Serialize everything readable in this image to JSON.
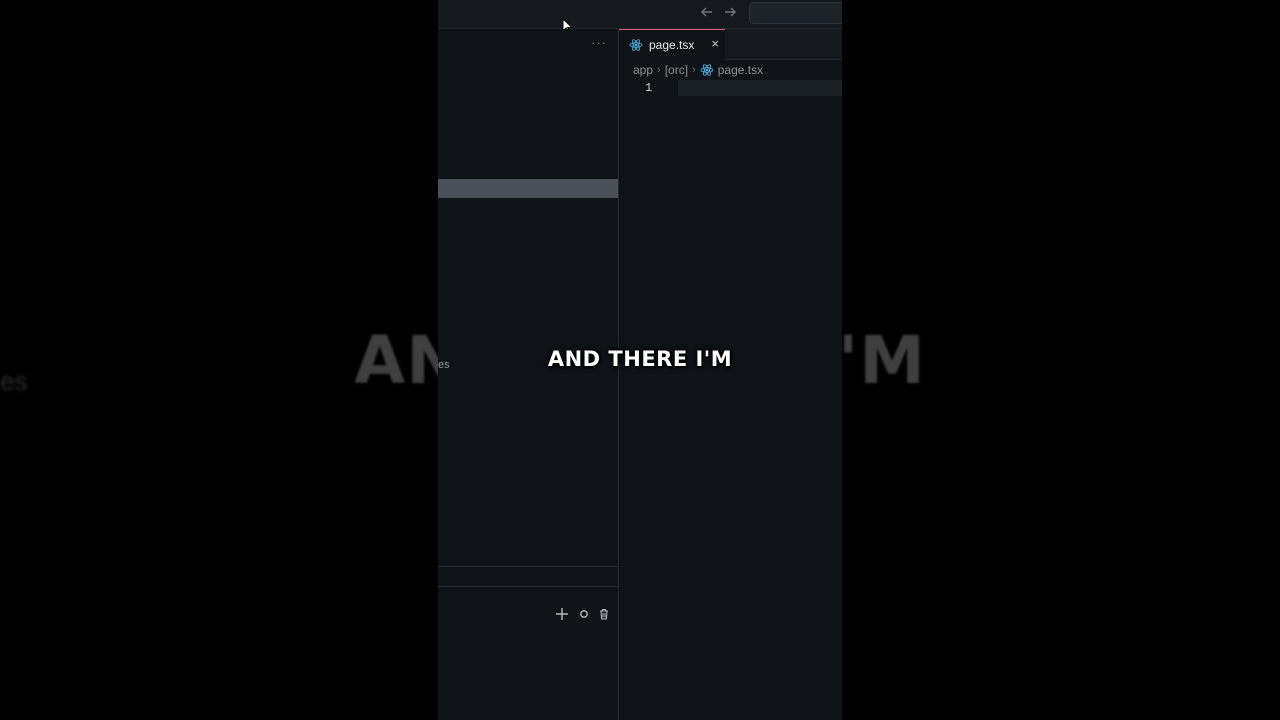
{
  "caption": {
    "text": "AND THERE I'M"
  },
  "background": {
    "left_ghost": "es",
    "mid_ghost": "es"
  },
  "titlebar": {
    "back_icon": "arrow-left-icon",
    "forward_icon": "arrow-right-icon"
  },
  "sidebar": {
    "more_label": "···"
  },
  "panel": {
    "add_icon": "plus-icon",
    "circle_icon": "circle-icon",
    "trash_icon": "trash-icon"
  },
  "editor": {
    "tab": {
      "label": "page.tsx",
      "close": "×"
    },
    "breadcrumb": [
      "app",
      "[orc]",
      "page.tsx"
    ],
    "line_number": "1"
  },
  "colors": {
    "accent_tab": "#e85c7a",
    "react_blue": "#4fa8d8",
    "editor_bg": "#0f1317"
  }
}
